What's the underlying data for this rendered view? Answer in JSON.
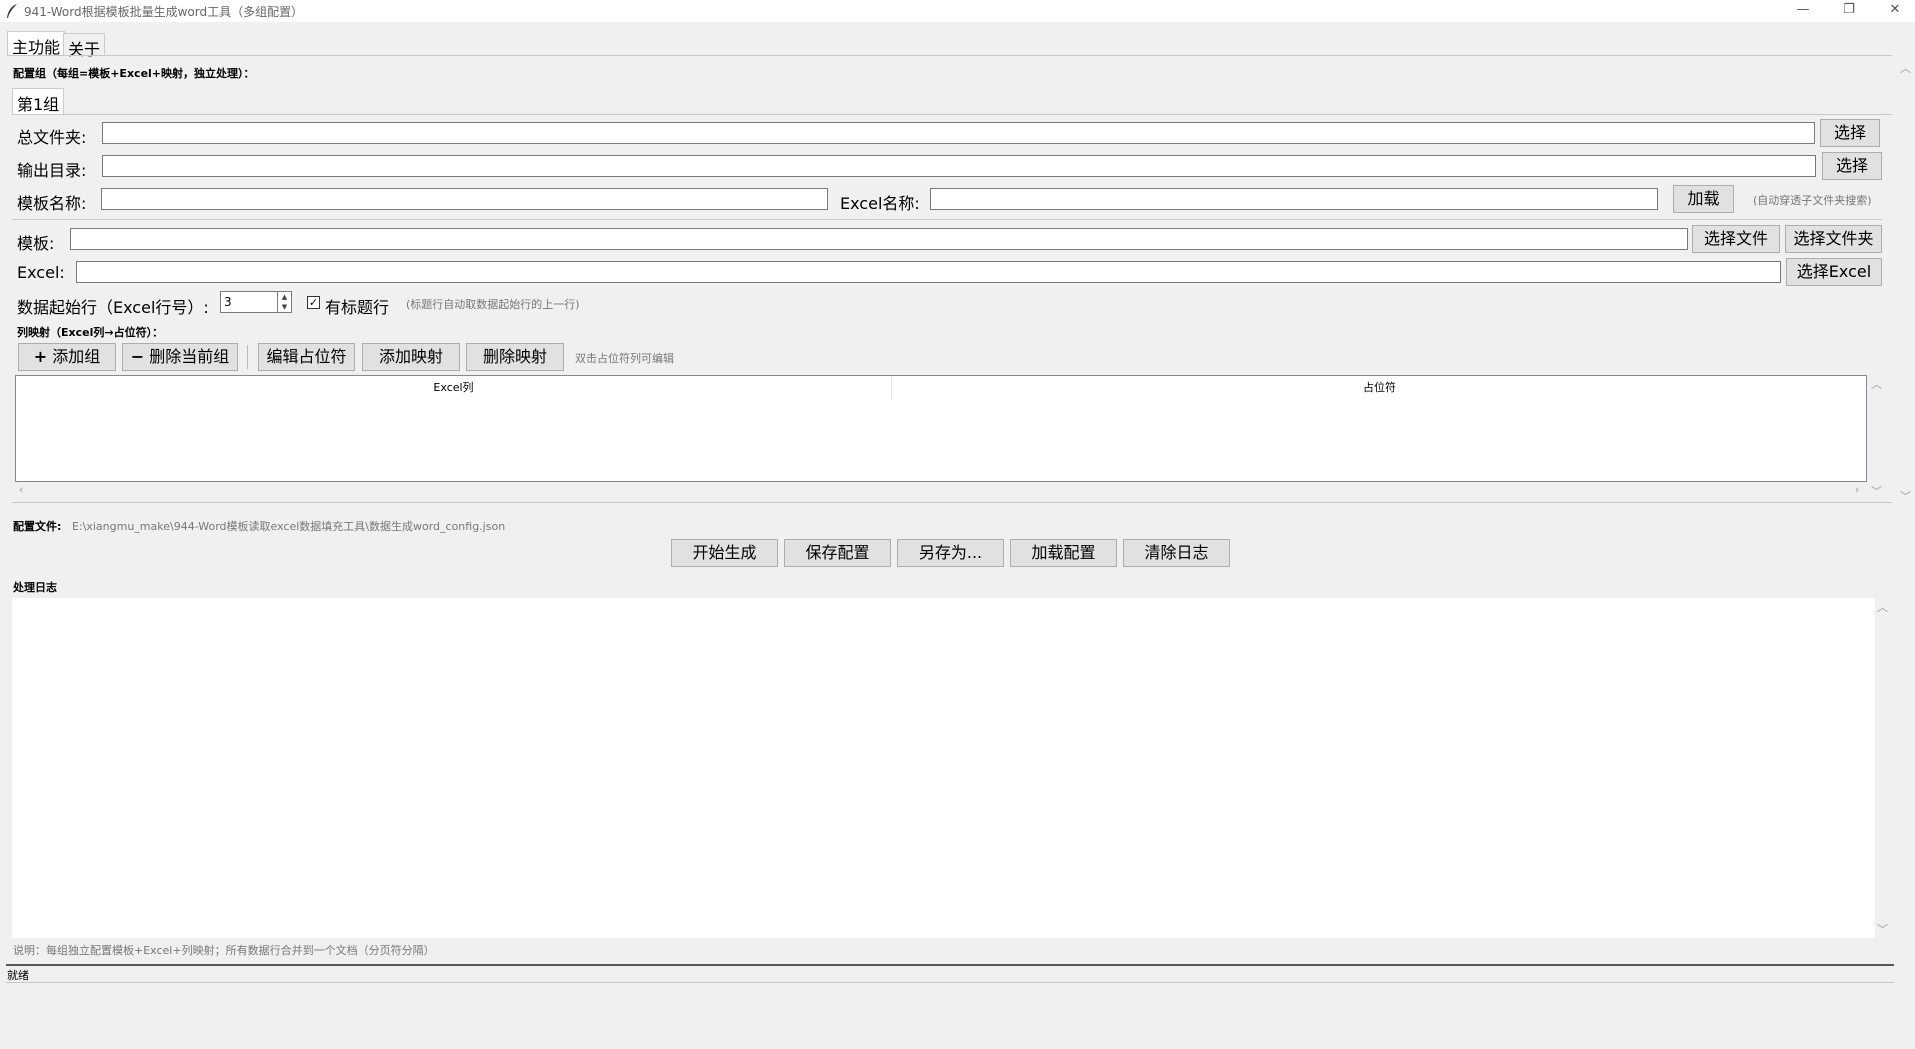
{
  "window": {
    "title": "941-Word根据模板批量生成word工具（多组配置）",
    "minimize": "—",
    "restore": "❐",
    "close": "✕"
  },
  "tabs": [
    {
      "label": "主功能"
    },
    {
      "label": "关于"
    }
  ],
  "config_group": {
    "heading": "配置组（每组=模板+Excel+映射，独立处理）：",
    "tab": "第1组",
    "root_folder_label": "总文件夹:",
    "root_folder_value": "",
    "root_folder_button": "选择",
    "output_dir_label": "输出目录:",
    "output_dir_value": "",
    "output_dir_button": "选择",
    "template_name_label": "模板名称:",
    "template_name_value": "",
    "excel_name_label": "Excel名称:",
    "excel_name_value": "",
    "load_button": "加载",
    "load_hint": "(自动穿透子文件夹搜索)",
    "template_label": "模板:",
    "template_value": "",
    "select_file_button": "选择文件",
    "select_folder_button": "选择文件夹",
    "excel_label": "Excel:",
    "excel_value": "",
    "select_excel_button": "选择Excel",
    "start_row_label": "数据起始行（Excel行号）:",
    "start_row_value": "3",
    "has_header_label": "有标题行",
    "has_header_checked": true,
    "has_header_hint": "(标题行自动取数据起始行的上一行)",
    "mapping_heading": "列映射（Excel列→占位符）：",
    "add_group_button": "添加组",
    "delete_group_button": "删除当前组",
    "edit_placeholder_button": "编辑占位符",
    "add_mapping_button": "添加映射",
    "delete_mapping_button": "删除映射",
    "mapping_hint": "双击占位符列可编辑",
    "columns": [
      "Excel列",
      "占位符"
    ]
  },
  "config_file": {
    "label": "配置文件:",
    "path": "E:\\xiangmu_make\\944-Word模板读取excel数据填充工具\\数据生成word_config.json"
  },
  "actions": {
    "start": "开始生成",
    "save": "保存配置",
    "save_as": "另存为...",
    "load": "加载配置",
    "clear_log": "清除日志"
  },
  "log": {
    "heading": "处理日志",
    "content": ""
  },
  "footer": {
    "note": "说明：每组独立配置模板+Excel+列映射；所有数据行合并到一个文档（分页符分隔）",
    "status": "就绪"
  }
}
